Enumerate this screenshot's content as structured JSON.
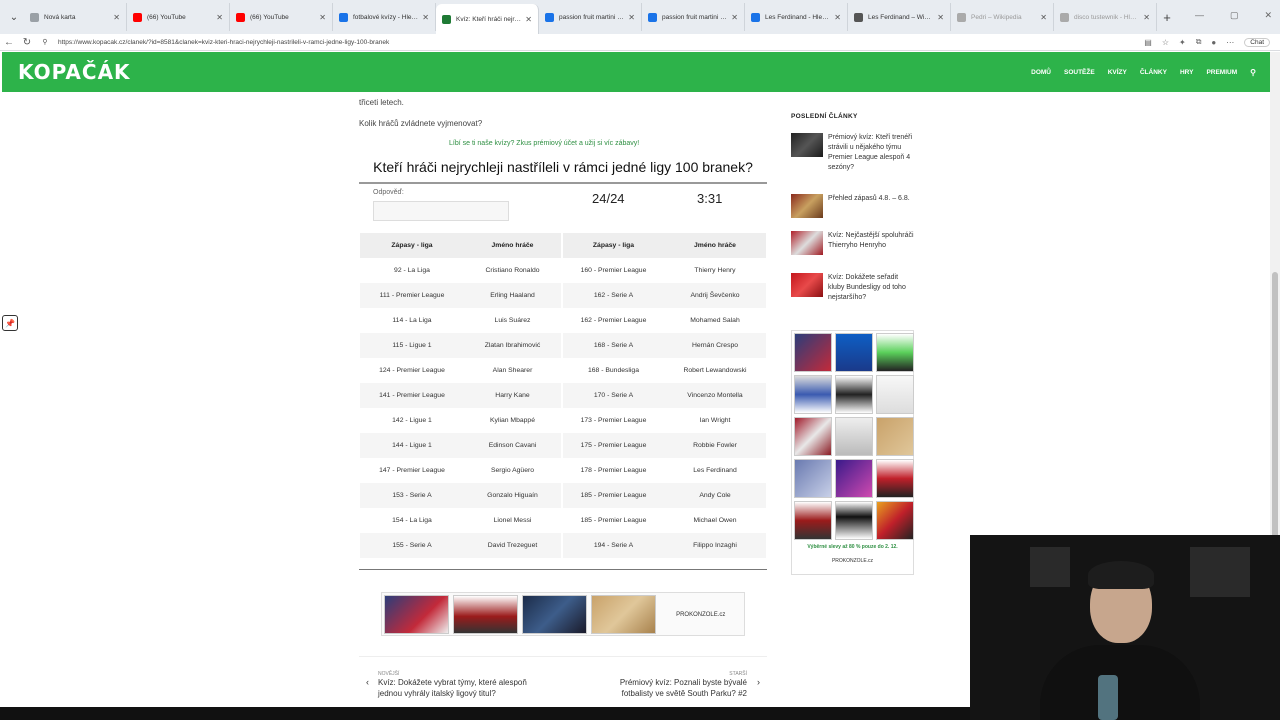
{
  "browser": {
    "tabs": [
      {
        "title": "Nová karta",
        "favicon_color": "#9aa0a6",
        "active": false
      },
      {
        "title": "(66) YouTube",
        "favicon_color": "#ff0000",
        "active": false
      },
      {
        "title": "(66) YouTube",
        "favicon_color": "#ff0000",
        "active": false
      },
      {
        "title": "fotbalové kvízy - Hledat",
        "favicon_color": "#1a73e8",
        "active": false
      },
      {
        "title": "Kvíz: Kteří hráči nejrychleji na...",
        "favicon_color": "#1f7a35",
        "active": true
      },
      {
        "title": "passion fruit martini - Hledat",
        "favicon_color": "#1a73e8",
        "active": false
      },
      {
        "title": "passion fruit martini - Hledat",
        "favicon_color": "#1a73e8",
        "active": false
      },
      {
        "title": "Les Ferdinand - Hledat",
        "favicon_color": "#1a73e8",
        "active": false
      },
      {
        "title": "Les Ferdinand – Wikipedie",
        "favicon_color": "#555555",
        "active": false
      },
      {
        "title": "Pedri – Wikipedia",
        "favicon_color": "#aaaaaa",
        "active": false
      },
      {
        "title": "disco tustewnik - Hledat",
        "favicon_color": "#aaaaaa",
        "active": false
      }
    ],
    "url": "https://www.kopacak.cz/clanek/?id=8581&clanek=kviz-kteri-hraci-nejrychleji-nastrileli-v-ramci-jedne-ligy-100-branek",
    "chat_label": "Chat"
  },
  "site": {
    "logo": "KOPAČÁK",
    "brand_color": "#2db34a",
    "nav": [
      "DOMŮ",
      "SOUTĚŽE",
      "KVÍZY",
      "ČLÁNKY",
      "HRY",
      "PREMIUM"
    ]
  },
  "article": {
    "intro_line": "třiceti letech.",
    "question": "Kolik hráčů zvládnete vyjmenovat?",
    "promo": "Líbí se ti naše kvízy? Zkus prémiový účet a užij si víc zábavy!",
    "quiz_title": "Kteří hráči nejrychleji nastříleli v rámci jedné ligy 100 branek?",
    "answer_label": "Odpověď:",
    "answer_value": "",
    "score": "24/24",
    "timer": "3:31",
    "table": {
      "headers": [
        "Zápasy - liga",
        "Jméno hráče",
        "Zápasy - liga",
        "Jméno hráče"
      ],
      "rows": [
        [
          "92 - La Liga",
          "Cristiano Ronaldo",
          "160 - Premier League",
          "Thierry Henry"
        ],
        [
          "111 - Premier League",
          "Erling Haaland",
          "162 - Serie A",
          "Andrij Ševčenko"
        ],
        [
          "114 - La Liga",
          "Luis Suárez",
          "162 - Premier League",
          "Mohamed Salah"
        ],
        [
          "115 - Ligue 1",
          "Zlatan Ibrahimović",
          "168 - Serie A",
          "Hernán Crespo"
        ],
        [
          "124 - Premier League",
          "Alan Shearer",
          "168 - Bundesliga",
          "Robert Lewandowski"
        ],
        [
          "141 - Premier League",
          "Harry Kane",
          "170 - Serie A",
          "Vincenzo Montella"
        ],
        [
          "142 - Ligue 1",
          "Kylian Mbappé",
          "173 - Premier League",
          "Ian Wright"
        ],
        [
          "144 - Ligue 1",
          "Edinson Cavani",
          "175 - Premier League",
          "Robbie Fowler"
        ],
        [
          "147 - Premier League",
          "Sergio Agüero",
          "178 - Premier League",
          "Les Ferdinand"
        ],
        [
          "153 - Serie A",
          "Gonzalo Higuaín",
          "185 - Premier League",
          "Andy Cole"
        ],
        [
          "154 - La Liga",
          "Lionel Messi",
          "185 - Premier League",
          "Michael Owen"
        ],
        [
          "155 - Serie A",
          "David Trezeguet",
          "194 - Serie A",
          "Filippo Inzaghi"
        ]
      ]
    },
    "ad_brand": "PROKONZOLE.cz",
    "prev": {
      "label": "NOVĚJŠÍ",
      "title": "Kvíz: Dokážete vybrat týmy, které alespoň jednou vyhrály italský ligový titul?"
    },
    "next": {
      "label": "STARŠÍ",
      "title": "Prémiový kvíz: Poznali byste bývalé fotbalisty ve světě South Parku? #2"
    }
  },
  "sidebar": {
    "heading": "POSLEDNÍ ČLÁNKY",
    "articles": [
      {
        "title": "Prémiový kvíz: Kteří trenéři strávili u nějakého týmu Premier League alespoň 4 sezóny?"
      },
      {
        "title": "Přehled zápasů 4.8. – 6.8."
      },
      {
        "title": "Kvíz: Nejčastější spoluhráči Thierryho Henryho"
      },
      {
        "title": "Kvíz: Dokážete seřadit kluby Bundesligy od toho nejstaršího?"
      }
    ],
    "ad_caption": "Výběrné slevy až 80 % pouze do 2. 12.",
    "ad_brand": "PROKONZOLE.cz"
  }
}
